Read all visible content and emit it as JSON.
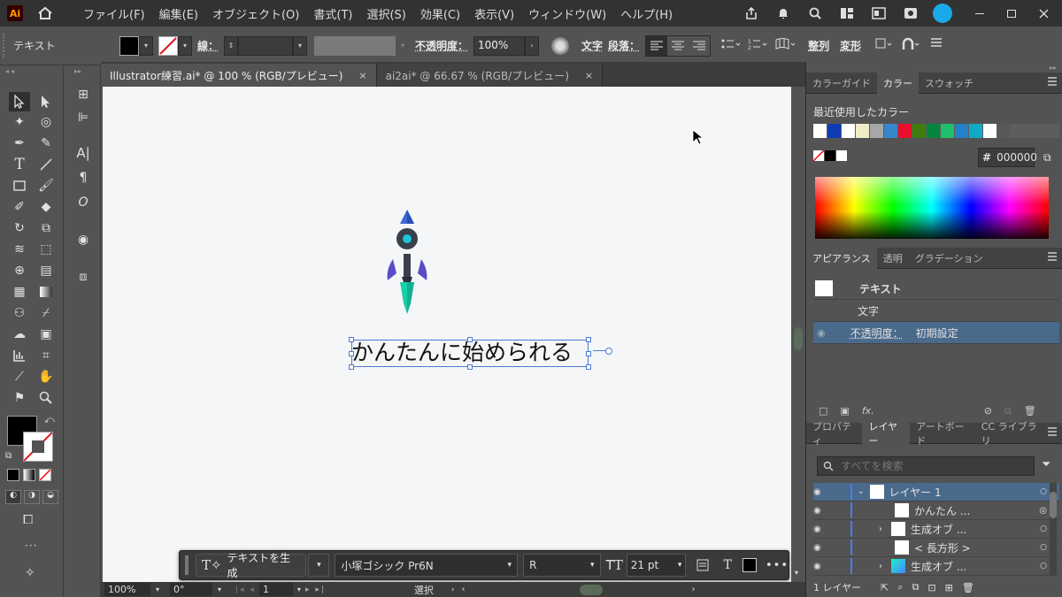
{
  "menubar": {
    "logo": "Ai",
    "items": [
      "ファイル(F)",
      "編集(E)",
      "オブジェクト(O)",
      "書式(T)",
      "選択(S)",
      "効果(C)",
      "表示(V)",
      "ウィンドウ(W)",
      "ヘルプ(H)"
    ]
  },
  "control": {
    "object_type": "テキスト",
    "stroke_label": "線：",
    "opacity_label": "不透明度：",
    "opacity_value": "100%",
    "char_label": "文字",
    "para_label": "段落：",
    "align_label": "整列",
    "transform_label": "変形"
  },
  "tabs": [
    {
      "label": "Illustrator練習.ai* @ 100 % (RGB/プレビュー)",
      "close": "×"
    },
    {
      "label": "ai2ai* @ 66.67 % (RGB/プレビュー)",
      "close": "×"
    }
  ],
  "canvas": {
    "text": "かんたんに始められる"
  },
  "contextbar": {
    "generate_text": "テキストを生成",
    "font_family": "小塚ゴシック Pr6N",
    "font_style": "R",
    "font_size": "21 pt",
    "more": "•••"
  },
  "status": {
    "zoom": "100%",
    "rotation": "0°",
    "artboard": "1",
    "mode": "選択"
  },
  "color_panel": {
    "tabs": [
      "カラーガイド",
      "カラー",
      "スウォッチ"
    ],
    "recent_label": "最近使用したカラー",
    "hex_symbol": "#",
    "hex": "000000",
    "recent_colors": [
      "#ffffff",
      "#0f3cb5",
      "#ffffff",
      "#f1ecc8",
      "#a7a7a7",
      "#3686c9",
      "#e8102a",
      "#3f7d0f",
      "#04873d",
      "#1fc06c",
      "#2480c9",
      "#10a9c6",
      "#ffffff",
      "#585858"
    ]
  },
  "appearance": {
    "tabs": [
      "アピアランス",
      "透明",
      "グラデーション"
    ],
    "title": "テキスト",
    "char": "文字",
    "opacity_label": "不透明度：",
    "opacity_value": "初期設定"
  },
  "layers_panel": {
    "tabs": [
      "プロパティ",
      "レイヤー",
      "アートボード",
      "CC ライブラリ"
    ],
    "search_placeholder": "すべてを検索",
    "layers": [
      {
        "name": "レイヤー 1"
      },
      {
        "name": "かんたん ..."
      },
      {
        "name": "生成オブ ..."
      },
      {
        "name": "< 長方形 >"
      },
      {
        "name": "生成オブ ..."
      }
    ],
    "count": "1 レイヤー"
  }
}
